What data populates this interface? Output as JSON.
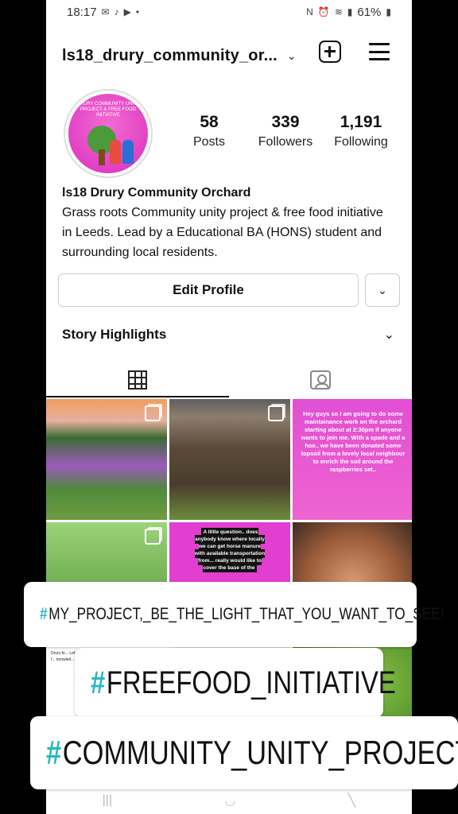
{
  "status_bar": {
    "time": "18:17",
    "battery": "61%"
  },
  "header": {
    "username": "ls18_drury_community_or..."
  },
  "avatar": {
    "label": "DRURY COMMUNITY UNITY PROJECT & FREE FOOD INITIATIVE"
  },
  "stats": [
    {
      "value": "58",
      "label": "Posts"
    },
    {
      "value": "339",
      "label": "Followers"
    },
    {
      "value": "1,191",
      "label": "Following"
    }
  ],
  "bio": {
    "name": "ls18 Drury Community Orchard",
    "text": "Grass roots Community unity project & free food initiative in Leeds. Lead by a Educational BA (HONS) student and surrounding local residents."
  },
  "buttons": {
    "edit_profile": "Edit Profile"
  },
  "highlights": {
    "label": "Story Highlights"
  },
  "posts": {
    "p3_text": "Hey guys so I am going to do some maintainance work on the orchard starting about at 2:30pm if anyone wants to join me. With a spade and a hoe.. we have been donated some topsoil from a lovely local neighbour to enrich the soil around the raspberries set..",
    "p5_text": "A little question.. does anybody know where locally we can get horse manure with available transportation from... really would like to cover the base of the",
    "p7_text": "Drury fe... Let's util... fail pote... childcare... (transfer... activity f... knowled..."
  },
  "hashtags": [
    {
      "symbol": "#",
      "text": "MY_PROJECT,_BE_THE_LIGHT_THAT_YOU_WANT_TO_SEE!"
    },
    {
      "symbol": "#",
      "text": "FREEFOOD_INITIATIVE"
    },
    {
      "symbol": "#",
      "text": "COMMUNITY_UNITY_PROJECT"
    }
  ],
  "colors": {
    "hashtag_symbol": "#29b6c8",
    "avatar_bg": "#e23ecf"
  }
}
